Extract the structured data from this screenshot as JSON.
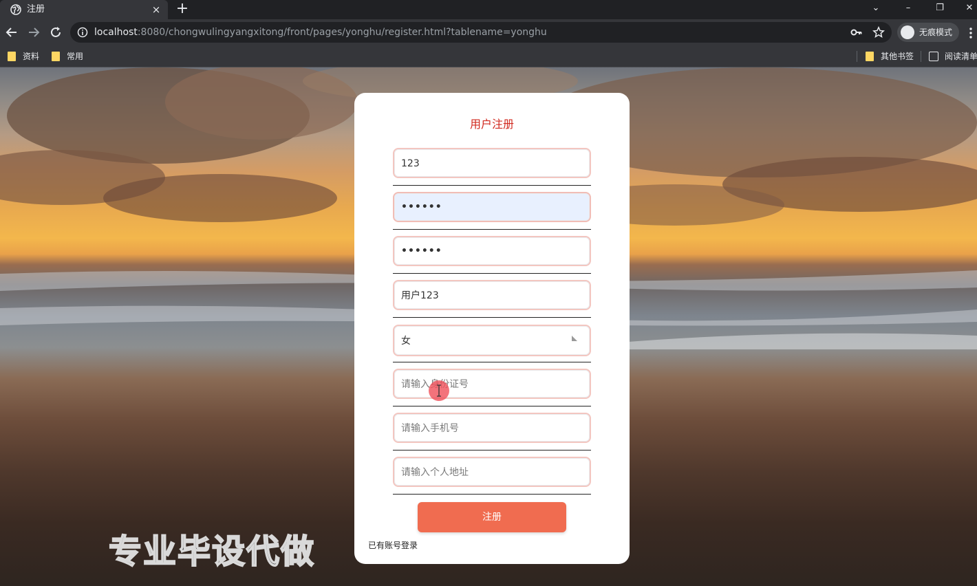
{
  "browser": {
    "tab_title": "注册",
    "tab_close": "×",
    "new_tab": "+",
    "url_host": "localhost",
    "url_rest": ":8080/chongwulingyangxitong/front/pages/yonghu/register.html?tablename=yonghu",
    "incognito_label": "无痕模式",
    "window_controls": {
      "dropdown": "⌄",
      "minimize": "–",
      "restore": "❐",
      "close": "✕"
    },
    "bookmarks": [
      {
        "label": "资料",
        "icon": "folder-icon"
      },
      {
        "label": "常用",
        "icon": "folder-icon"
      }
    ],
    "bookmarks_right": [
      {
        "label": "其他书签",
        "icon": "folder-icon"
      },
      {
        "label": "阅读清单",
        "icon": "reading-list-icon"
      }
    ],
    "icons": [
      "globe-icon",
      "back-icon",
      "forward-icon",
      "reload-icon",
      "info-icon",
      "key-icon",
      "star-icon",
      "incognito-icon",
      "menu-icon"
    ]
  },
  "form": {
    "title": "用户注册",
    "title_color": "#d0281e",
    "fields": [
      {
        "name": "account",
        "value": "123",
        "placeholder": ""
      },
      {
        "name": "password",
        "value": "••••••",
        "placeholder": ""
      },
      {
        "name": "confirm_password",
        "value": "••••••",
        "placeholder": ""
      },
      {
        "name": "username",
        "value": "用户123",
        "placeholder": ""
      },
      {
        "name": "gender",
        "value": "女",
        "placeholder": ""
      },
      {
        "name": "id_card",
        "value": "",
        "placeholder": "请输入身份证号"
      },
      {
        "name": "phone",
        "value": "",
        "placeholder": "请输入手机号"
      },
      {
        "name": "address",
        "value": "",
        "placeholder": "请输入个人地址"
      }
    ],
    "submit_label": "注册",
    "submit_color": "#f06c50",
    "login_link": "已有账号登录"
  },
  "watermark": "专业毕设代做"
}
